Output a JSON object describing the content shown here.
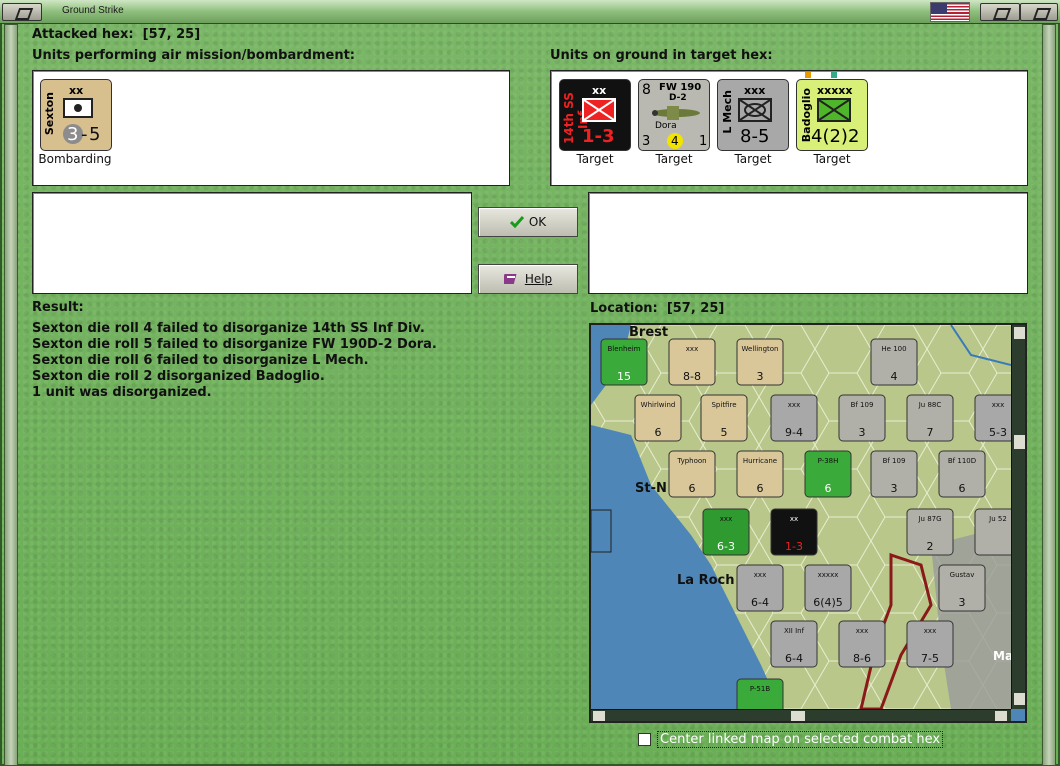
{
  "window": {
    "title": "Ground Strike"
  },
  "attacked_hex": {
    "label": "Attacked hex:",
    "value": "[57, 25]"
  },
  "air_units": {
    "header": "Units performing air mission/bombardment:",
    "items": [
      {
        "name": "Sexton",
        "size": "xx",
        "attack": "3",
        "move": "5",
        "status": "Bombarding"
      }
    ]
  },
  "ground_units": {
    "header": "Units on ground in target hex:",
    "items": [
      {
        "name": "14th SS Inf.",
        "size": "xx",
        "values": "1-3",
        "status": "Target",
        "color": "#111111"
      },
      {
        "name": "FW 190",
        "sub": "D-2",
        "pilot": "Dora",
        "top_left": "8",
        "bottom_left": "3",
        "mid": "4",
        "bottom_right": "1",
        "status": "Target",
        "color": "#b9b9b2"
      },
      {
        "name": "L Mech",
        "size": "xxx",
        "values": "8-5",
        "status": "Target",
        "color": "#a8a8a8"
      },
      {
        "name": "Badoglio",
        "size": "xxxxx",
        "values": "4(2)2",
        "status": "Target",
        "color": "#d8ef78"
      }
    ]
  },
  "buttons": {
    "ok": "OK",
    "help": "Help"
  },
  "result": {
    "label": "Result:",
    "lines": [
      "Sexton die roll 4 failed to disorganize 14th SS Inf Div.",
      "Sexton die roll 5 failed to disorganize FW 190D-2 Dora.",
      "Sexton die roll 6 failed to disorganize L Mech.",
      "Sexton die roll 2 disorganized Badoglio.",
      "1 unit was disorganized."
    ]
  },
  "location": {
    "label": "Location:",
    "value": "[57, 25]"
  },
  "map": {
    "places": [
      "Brest",
      "St-N",
      "La Roch",
      "Ma"
    ],
    "units": [
      {
        "name": "Blenheim",
        "values": "15",
        "color": "#3aaa3a"
      },
      {
        "name": "xxx",
        "values": "8-8",
        "color": "#d9c79a"
      },
      {
        "name": "Wellington",
        "values": "3",
        "color": "#d9c79a"
      },
      {
        "name": "He 100",
        "values": "4",
        "color": "#b0b0a8"
      },
      {
        "name": "Whirlwind",
        "values": "6",
        "color": "#d9c79a"
      },
      {
        "name": "Spitfire",
        "values": "5",
        "color": "#d9c79a"
      },
      {
        "name": "xxx",
        "values": "9-4",
        "color": "#a8a8a8"
      },
      {
        "name": "Bf 109",
        "values": "3",
        "color": "#b0b0a8"
      },
      {
        "name": "Ju 88C",
        "values": "7",
        "color": "#b0b0a8"
      },
      {
        "name": "xxx",
        "values": "5-3",
        "color": "#a8a8a8"
      },
      {
        "name": "Typhoon",
        "values": "6",
        "color": "#d9c79a"
      },
      {
        "name": "Hurricane",
        "values": "6",
        "color": "#d9c79a"
      },
      {
        "name": "P-38H",
        "values": "6",
        "color": "#3aaa3a"
      },
      {
        "name": "Bf 109",
        "values": "3",
        "color": "#b0b0a8"
      },
      {
        "name": "Bf 110D",
        "values": "6",
        "color": "#b0b0a8"
      },
      {
        "name": "xxx",
        "values": "6-3",
        "color": "#2f9a2f"
      },
      {
        "name": "xx",
        "values": "1-3",
        "color": "#111111"
      },
      {
        "name": "Ju 87G",
        "values": "2",
        "color": "#b0b0a8"
      },
      {
        "name": "Ju 52",
        "values": "",
        "color": "#b0b0a8"
      },
      {
        "name": "xxx",
        "values": "6-4",
        "color": "#a8a8a8"
      },
      {
        "name": "xxxxx",
        "values": "6(4)5",
        "color": "#a8a8a8"
      },
      {
        "name": "Gustav",
        "values": "3",
        "color": "#b0b0a8"
      },
      {
        "name": "XII Inf",
        "values": "6-4",
        "color": "#a8a8a8"
      },
      {
        "name": "xxx",
        "values": "8-6",
        "color": "#a8a8a8"
      },
      {
        "name": "xxx",
        "values": "7-5",
        "color": "#a8a8a8"
      },
      {
        "name": "P-51B",
        "values": "",
        "color": "#3aaa3a"
      }
    ]
  },
  "checkbox": {
    "label": "Center linked map on selected combat hex",
    "checked": false
  }
}
